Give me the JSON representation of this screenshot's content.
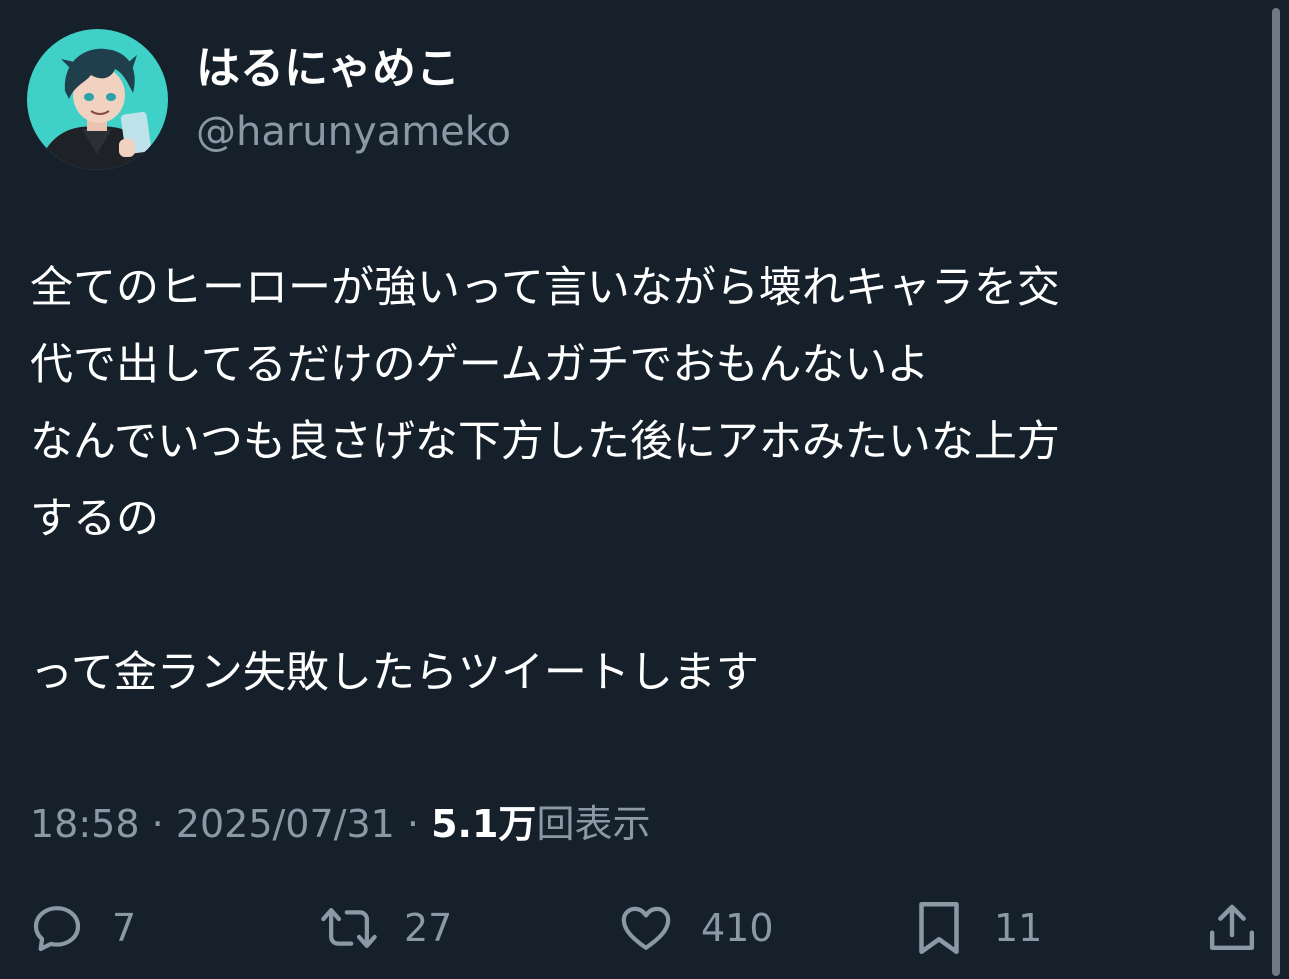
{
  "author": {
    "display_name": "はるにゃめこ",
    "handle": "@harunyameko"
  },
  "tweet": {
    "lines": [
      "全てのヒーローが強いって言いながら壊れキャラを交",
      "代で出してるだけのゲームガチでおもんないよ",
      "なんでいつも良さげな下方した後にアホみたいな上方",
      "するの",
      "",
      "って金ラン失敗したらツイートします"
    ]
  },
  "meta": {
    "time": "18:58",
    "separator": "·",
    "date": "2025/07/31",
    "views_count": "5.1万",
    "views_label": "回表示"
  },
  "actions": {
    "reply": {
      "icon": "reply-icon",
      "count": "7"
    },
    "retweet": {
      "icon": "retweet-icon",
      "count": "27"
    },
    "like": {
      "icon": "heart-icon",
      "count": "410"
    },
    "bookmark": {
      "icon": "bookmark-icon",
      "count": "11"
    },
    "share": {
      "icon": "share-icon"
    }
  },
  "colors": {
    "background": "#15202b",
    "primary_text": "#ffffff",
    "secondary_text": "#8b98a5"
  }
}
